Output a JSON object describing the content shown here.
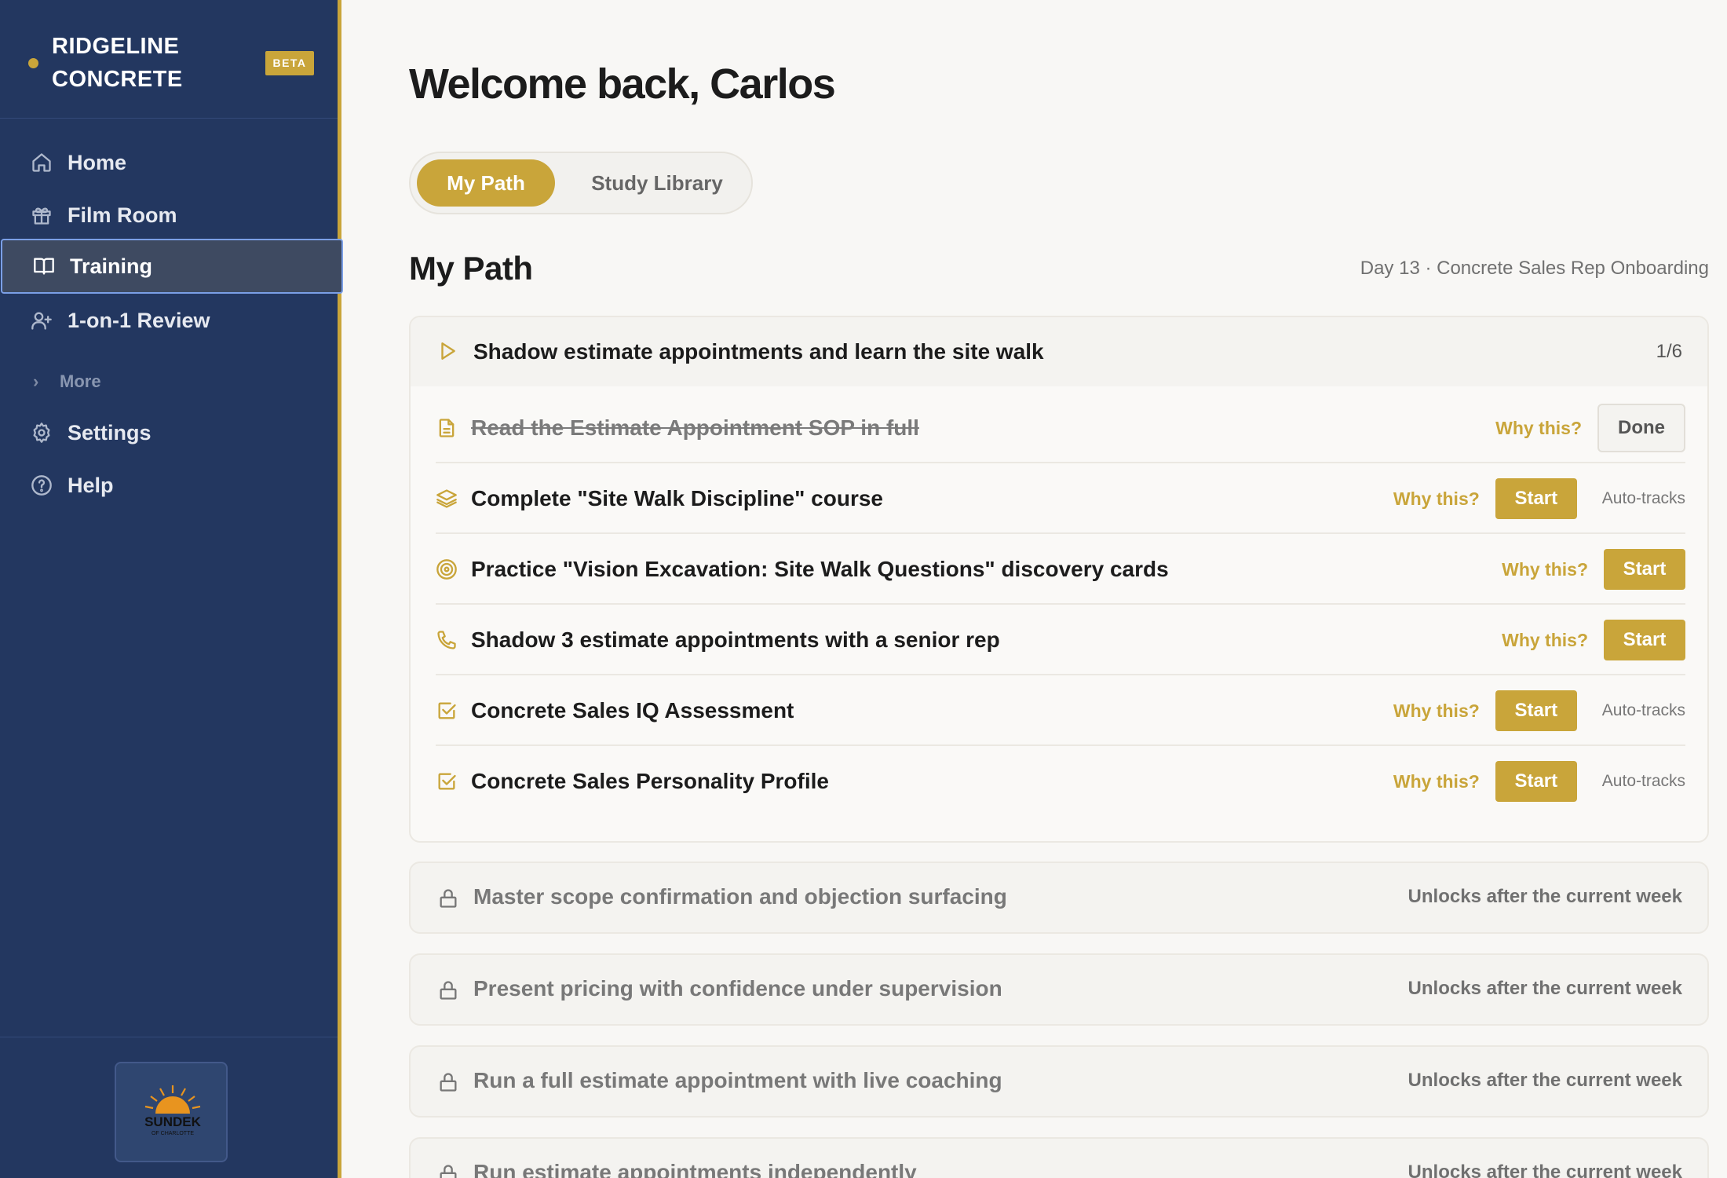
{
  "brand": {
    "name": "RIDGELINE CONCRETE",
    "badge": "BETA"
  },
  "sidebar": {
    "items": [
      {
        "label": "Home",
        "icon": "home-icon"
      },
      {
        "label": "Film Room",
        "icon": "gift-icon"
      },
      {
        "label": "Training",
        "icon": "book-open-icon",
        "active": true
      },
      {
        "label": "1-on-1 Review",
        "icon": "user-plus-icon"
      }
    ],
    "more_label": "More",
    "bottom_items": [
      {
        "label": "Settings",
        "icon": "gear-icon"
      },
      {
        "label": "Help",
        "icon": "help-circle-icon"
      }
    ],
    "footer_logo": {
      "text": "SUNDEK",
      "subtext": "OF CHARLOTTE"
    }
  },
  "main": {
    "welcome": "Welcome back, Carlos",
    "tabs": [
      {
        "label": "My Path",
        "active": true
      },
      {
        "label": "Study Library",
        "active": false
      }
    ],
    "section_title": "My Path",
    "section_meta": "Day 13 · Concrete Sales Rep Onboarding",
    "current_week": {
      "title": "Shadow estimate appointments and learn the site walk",
      "count": "1/6",
      "tasks": [
        {
          "label": "Read the Estimate Appointment SOP in full",
          "icon": "file-text-icon",
          "why": "Why this?",
          "action": "Done",
          "completed": true,
          "auto": ""
        },
        {
          "label": "Complete \"Site Walk Discipline\" course",
          "icon": "layers-icon",
          "why": "Why this?",
          "action": "Start",
          "completed": false,
          "auto": "Auto-tracks"
        },
        {
          "label": "Practice \"Vision Excavation: Site Walk Questions\" discovery cards",
          "icon": "target-icon",
          "why": "Why this?",
          "action": "Start",
          "completed": false,
          "auto": ""
        },
        {
          "label": "Shadow 3 estimate appointments with a senior rep",
          "icon": "phone-icon",
          "why": "Why this?",
          "action": "Start",
          "completed": false,
          "auto": ""
        },
        {
          "label": "Concrete Sales IQ Assessment",
          "icon": "check-square-icon",
          "why": "Why this?",
          "action": "Start",
          "completed": false,
          "auto": "Auto-tracks"
        },
        {
          "label": "Concrete Sales Personality Profile",
          "icon": "check-square-icon",
          "why": "Why this?",
          "action": "Start",
          "completed": false,
          "auto": "Auto-tracks"
        }
      ]
    },
    "locked_weeks": [
      {
        "title": "Master scope confirmation and objection surfacing",
        "note": "Unlocks after the current week"
      },
      {
        "title": "Present pricing with confidence under supervision",
        "note": "Unlocks after the current week"
      },
      {
        "title": "Run a full estimate appointment with live coaching",
        "note": "Unlocks after the current week"
      },
      {
        "title": "Run estimate appointments independently",
        "note": "Unlocks after the current week"
      }
    ]
  },
  "colors": {
    "sidebar_bg": "#233760",
    "accent": "#c9a53a",
    "page_bg": "#f8f7f5"
  }
}
